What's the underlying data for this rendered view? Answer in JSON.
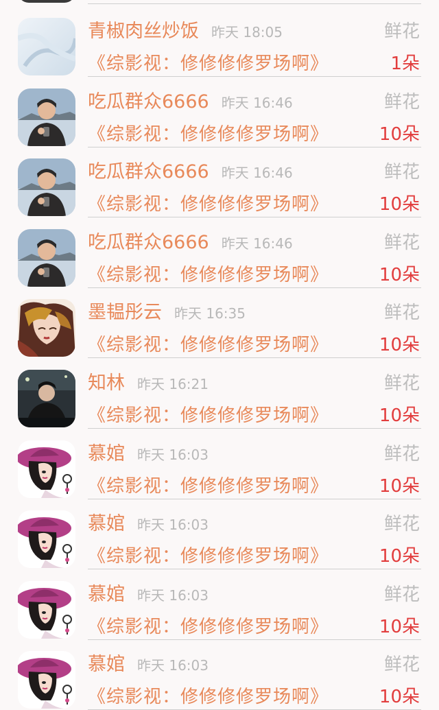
{
  "rows": [
    {
      "name": "青椒肉丝炒饭",
      "time": "昨天 18:05",
      "gift": "鲜花",
      "title": "《综影视：修修修修罗场啊》",
      "count": "1朵",
      "avatar": "avatar-winter"
    },
    {
      "name": "吃瓜群众6666",
      "time": "昨天 16:46",
      "gift": "鲜花",
      "title": "《综影视：修修修修罗场啊》",
      "count": "10朵",
      "avatar": "avatar-man-phone"
    },
    {
      "name": "吃瓜群众6666",
      "time": "昨天 16:46",
      "gift": "鲜花",
      "title": "《综影视：修修修修罗场啊》",
      "count": "10朵",
      "avatar": "avatar-man-phone"
    },
    {
      "name": "吃瓜群众6666",
      "time": "昨天 16:46",
      "gift": "鲜花",
      "title": "《综影视：修修修修罗场啊》",
      "count": "10朵",
      "avatar": "avatar-man-phone"
    },
    {
      "name": "墨韫彤云",
      "time": "昨天 16:35",
      "gift": "鲜花",
      "title": "《综影视：修修修修罗场啊》",
      "count": "10朵",
      "avatar": "avatar-painted-woman"
    },
    {
      "name": "知林",
      "time": "昨天 16:21",
      "gift": "鲜花",
      "title": "《综影视：修修修修罗场啊》",
      "count": "10朵",
      "avatar": "avatar-dark-man"
    },
    {
      "name": "慕婠",
      "time": "昨天 16:03",
      "gift": "鲜花",
      "title": "《综影视：修修修修罗场啊》",
      "count": "10朵",
      "avatar": "avatar-hat-lady"
    },
    {
      "name": "慕婠",
      "time": "昨天 16:03",
      "gift": "鲜花",
      "title": "《综影视：修修修修罗场啊》",
      "count": "10朵",
      "avatar": "avatar-hat-lady"
    },
    {
      "name": "慕婠",
      "time": "昨天 16:03",
      "gift": "鲜花",
      "title": "《综影视：修修修修罗场啊》",
      "count": "10朵",
      "avatar": "avatar-hat-lady"
    },
    {
      "name": "慕婠",
      "time": "昨天 16:03",
      "gift": "鲜花",
      "title": "《综影视：修修修修罗场啊》",
      "count": "10朵",
      "avatar": "avatar-hat-lady"
    }
  ],
  "colors": {
    "name": "#e8895a",
    "time": "#b8b8b8",
    "count": "#e23d3d",
    "gift": "#bdbdbd"
  }
}
